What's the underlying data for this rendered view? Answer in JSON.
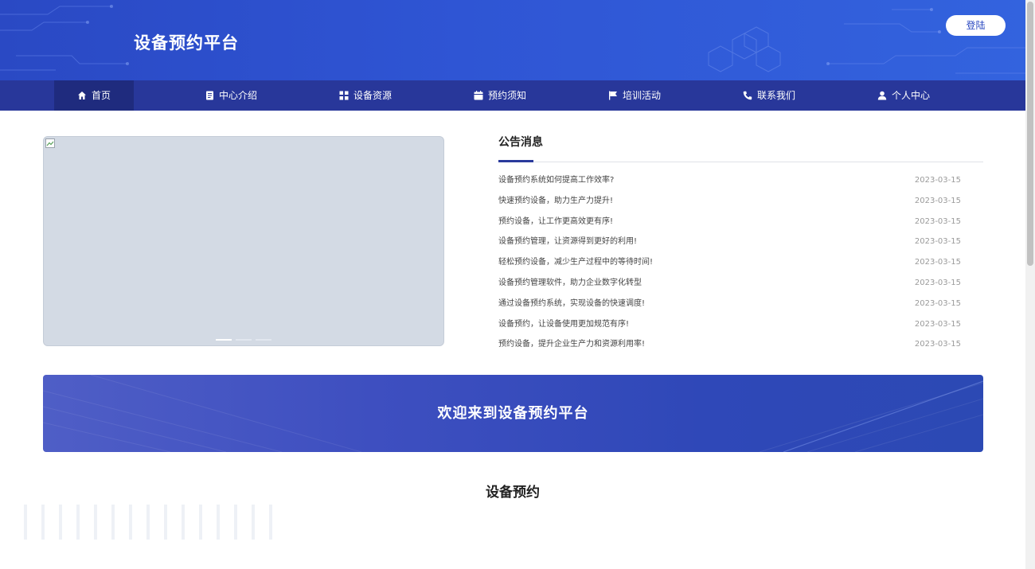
{
  "header": {
    "title": "设备预约平台",
    "login_label": "登陆"
  },
  "nav": {
    "items": [
      {
        "label": "首页",
        "icon": "home-icon",
        "active": true
      },
      {
        "label": "中心介绍",
        "icon": "document-icon"
      },
      {
        "label": "设备资源",
        "icon": "grid-icon"
      },
      {
        "label": "预约须知",
        "icon": "calendar-icon"
      },
      {
        "label": "培训活动",
        "icon": "flag-icon"
      },
      {
        "label": "联系我们",
        "icon": "phone-icon"
      },
      {
        "label": "个人中心",
        "icon": "user-icon"
      }
    ]
  },
  "carousel": {
    "slide_count": 3,
    "active_index": 0
  },
  "notice": {
    "title": "公告消息",
    "items": [
      {
        "title": "设备预约系统如何提高工作效率?",
        "date": "2023-03-15"
      },
      {
        "title": "快速预约设备，助力生产力提升!",
        "date": "2023-03-15"
      },
      {
        "title": "预约设备，让工作更高效更有序!",
        "date": "2023-03-15"
      },
      {
        "title": "设备预约管理，让资源得到更好的利用!",
        "date": "2023-03-15"
      },
      {
        "title": "轻松预约设备，减少生产过程中的等待时间!",
        "date": "2023-03-15"
      },
      {
        "title": "设备预约管理软件，助力企业数字化转型",
        "date": "2023-03-15"
      },
      {
        "title": "通过设备预约系统，实现设备的快速调度!",
        "date": "2023-03-15"
      },
      {
        "title": "设备预约，让设备使用更加规范有序!",
        "date": "2023-03-15"
      },
      {
        "title": "预约设备，提升企业生产力和资源利用率!",
        "date": "2023-03-15"
      }
    ]
  },
  "banner": {
    "text": "欢迎来到设备预约平台"
  },
  "section": {
    "title": "设备预约"
  },
  "colors": {
    "header_blue": "#2f55d4",
    "nav_blue": "#28379a",
    "nav_active": "#1f2b7e",
    "accent": "#2a3a9c"
  }
}
